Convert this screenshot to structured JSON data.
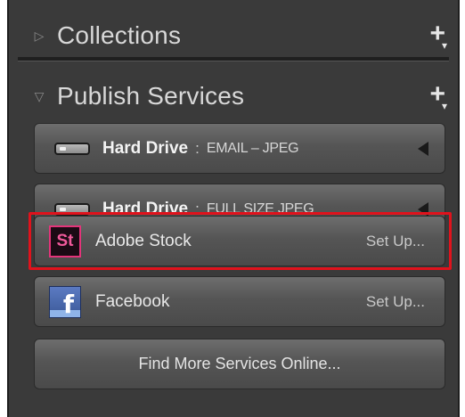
{
  "panel": {
    "collections": {
      "title": "Collections",
      "add_icon": "plus-icon"
    },
    "publish_services": {
      "title": "Publish Services",
      "add_icon": "plus-icon"
    }
  },
  "services": [
    {
      "name": "Hard Drive",
      "separator": ":",
      "subtitle": "EMAIL – JPEG",
      "icon": "hard-drive-icon"
    },
    {
      "name": "Hard Drive",
      "separator": ":",
      "subtitle": "FULL SIZE JPEG",
      "icon": "hard-drive-icon"
    },
    {
      "name": "Adobe Stock",
      "action": "Set Up...",
      "icon": "adobe-stock-icon",
      "icon_text": "St",
      "highlighted": true
    },
    {
      "name": "Facebook",
      "action": "Set Up...",
      "icon": "facebook-icon",
      "icon_text": "f"
    }
  ],
  "find_more": {
    "label": "Find More Services Online..."
  },
  "colors": {
    "panel_bg": "#3a3a3a",
    "highlight": "#e0121c",
    "stock_pink": "#e4347a",
    "facebook_blue": "#3b5998"
  }
}
